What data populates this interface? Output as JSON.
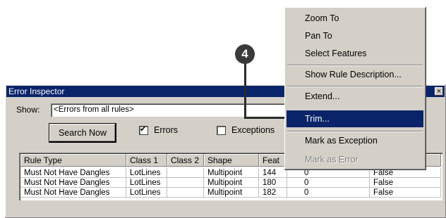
{
  "window": {
    "title": "Error Inspector",
    "close_glyph": "×",
    "show_label": "Show:",
    "show_value": "<Errors from all rules>",
    "search_button": "Search Now",
    "errors_label": "Errors",
    "errors_checked": true,
    "exceptions_label": "Exceptions",
    "exceptions_checked": false
  },
  "table": {
    "columns": [
      "Rule Type",
      "Class 1",
      "Class 2",
      "Shape",
      "Feat"
    ],
    "rows": [
      {
        "rule_type": "Must Not Have Dangles",
        "class1": "LotLines",
        "class2": "",
        "shape": "Multipoint",
        "feat": "144",
        "col6": "0",
        "col7": "False"
      },
      {
        "rule_type": "Must Not Have Dangles",
        "class1": "LotLines",
        "class2": "",
        "shape": "Multipoint",
        "feat": "180",
        "col6": "0",
        "col7": "False"
      },
      {
        "rule_type": "Must Not Have Dangles",
        "class1": "LotLines",
        "class2": "",
        "shape": "Multipoint",
        "feat": "182",
        "col6": "0",
        "col7": "False"
      }
    ]
  },
  "context_menu": {
    "items": [
      "Zoom To",
      "Pan To",
      "Select Features",
      "Show Rule Description...",
      "Extend...",
      "Trim...",
      "Mark as Exception",
      "Mark as Error"
    ],
    "selected": "Trim...",
    "disabled": [
      "Mark as Error"
    ]
  },
  "callout": {
    "number": "4"
  }
}
